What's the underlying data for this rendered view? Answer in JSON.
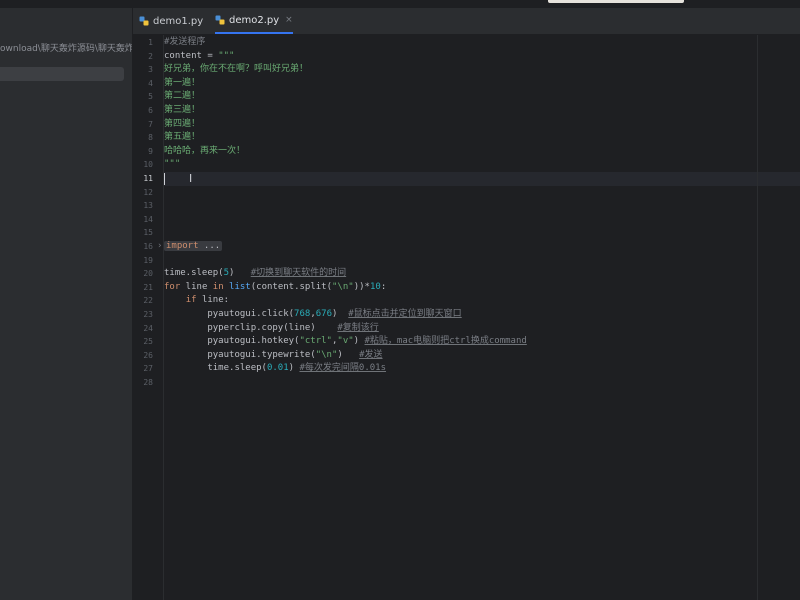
{
  "colors": {
    "editor_bg": "#1e1f22",
    "panel_bg": "#2b2d30",
    "accent": "#3574f0",
    "keyword": "#cf8e6d",
    "string": "#6aab73",
    "comment": "#7a7e85",
    "number": "#2aacb8"
  },
  "project_panel": {
    "path": "ownload\\聊天轰炸源码\\聊天轰炸源码"
  },
  "tabs": [
    {
      "label": "demo1.py",
      "icon": "python-file-icon",
      "active": false
    },
    {
      "label": "demo2.py",
      "icon": "python-file-icon",
      "active": true,
      "close": "×"
    }
  ],
  "editor": {
    "current_line": 11,
    "lines": [
      {
        "no": "1",
        "code": "#发送程序"
      },
      {
        "no": "2",
        "code": "content = \"\"\""
      },
      {
        "no": "3",
        "code": "好兄弟，你在不在啊？呼叫好兄弟！"
      },
      {
        "no": "4",
        "code": "第一遍！"
      },
      {
        "no": "5",
        "code": "第二遍！"
      },
      {
        "no": "6",
        "code": "第三遍！"
      },
      {
        "no": "7",
        "code": "第四遍！"
      },
      {
        "no": "8",
        "code": "第五遍！"
      },
      {
        "no": "9",
        "code": "哈哈哈，再来一次！"
      },
      {
        "no": "10",
        "code": "\"\"\""
      },
      {
        "no": "11",
        "code": ""
      },
      {
        "no": "12",
        "code": ""
      },
      {
        "no": "13",
        "code": ""
      },
      {
        "no": "14",
        "code": ""
      },
      {
        "no": "15",
        "code": ""
      },
      {
        "no": "16",
        "code": "import ..."
      },
      {
        "no": "19",
        "code": ""
      },
      {
        "no": "20",
        "code": "time.sleep(5)   #切换到聊天软件的时间"
      },
      {
        "no": "21",
        "code": "for line in list(content.split(\"\\n\"))*10:"
      },
      {
        "no": "22",
        "code": "    if line:"
      },
      {
        "no": "23",
        "code": "        pyautogui.click(768,676)  #鼠标点击并定位到聊天窗口"
      },
      {
        "no": "24",
        "code": "        pyperclip.copy(line)    #复制该行"
      },
      {
        "no": "25",
        "code": "        pyautogui.hotkey(\"ctrl\",\"v\") #粘贴，mac电脑则把ctrl换成command"
      },
      {
        "no": "26",
        "code": "        pyautogui.typewrite(\"\\n\")   #发送"
      },
      {
        "no": "27",
        "code": "        time.sleep(0.01) #每次发完间隔0.01s"
      },
      {
        "no": "28",
        "code": ""
      }
    ],
    "fold_icon": "›"
  }
}
